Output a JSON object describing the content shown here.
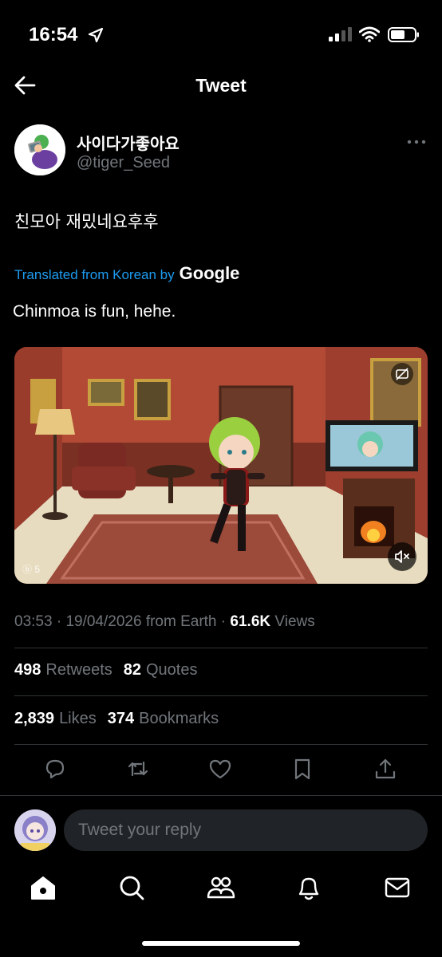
{
  "status_bar": {
    "time": "16:54",
    "icons": [
      "location-arrow-icon",
      "signal-icon",
      "wifi-icon",
      "battery-icon"
    ]
  },
  "header": {
    "title": "Tweet",
    "back_icon": "arrow-left-icon"
  },
  "tweet": {
    "author": {
      "display_name": "사이다가좋아요",
      "handle": "@tiger_Seed"
    },
    "text": "친모아 재밌네요후후",
    "translation_notice": "Translated from Korean by",
    "translation_provider": "Google",
    "translated_text": "Chinmoa is fun, hehe.",
    "media": {
      "type": "video",
      "caption_icon": "captions-icon",
      "mute_icon": "speaker-muted-icon",
      "watermark": "ⓑ 5"
    },
    "meta": {
      "time": "03:53",
      "date": "19/04/2026",
      "source": "from Earth",
      "views_count": "61.6K",
      "views_label": "Views"
    },
    "stats": {
      "retweets_count": "498",
      "retweets_label": "Retweets",
      "quotes_count": "82",
      "quotes_label": "Quotes",
      "likes_count": "2,839",
      "likes_label": "Likes",
      "bookmarks_count": "374",
      "bookmarks_label": "Bookmarks"
    },
    "actions": [
      "reply-icon",
      "retweet-icon",
      "like-icon",
      "bookmark-icon",
      "share-icon"
    ]
  },
  "reply_bar": {
    "placeholder": "Tweet your reply"
  },
  "tab_bar": [
    "home-icon",
    "search-icon",
    "communities-icon",
    "notifications-icon",
    "messages-icon"
  ],
  "colors": {
    "background": "#000000",
    "text": "#e7e9ea",
    "muted": "#71767b",
    "accent": "#1d9bf0",
    "divider": "#2f3336",
    "input_bg": "#202327"
  }
}
